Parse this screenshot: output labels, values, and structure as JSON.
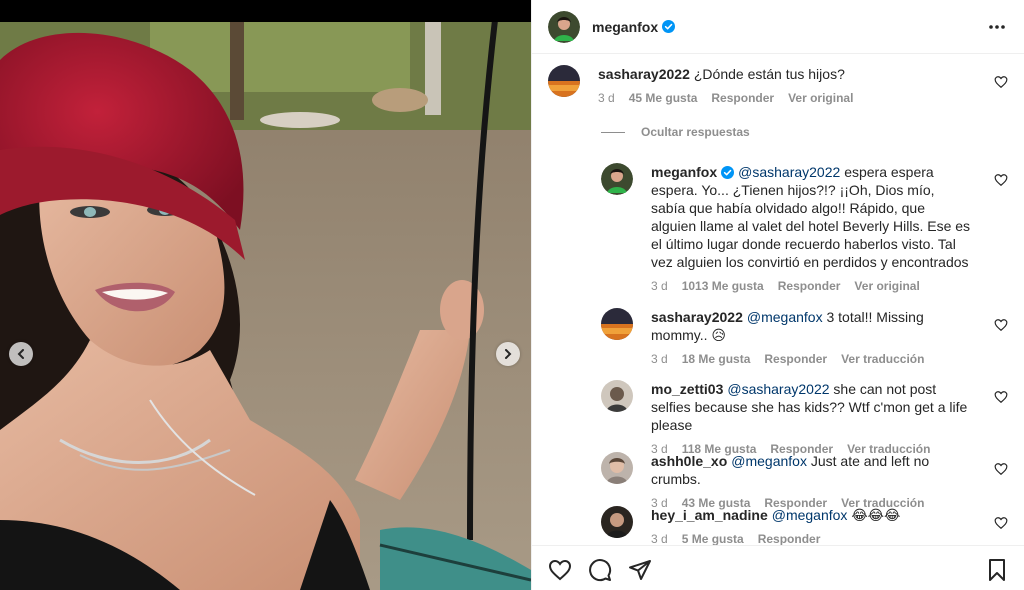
{
  "post": {
    "author": "meganfox",
    "verified": true
  },
  "thread": {
    "hide_replies_label": "Ocultar respuestas",
    "reply_label": "Responder",
    "comments": [
      {
        "user": "sasharay2022",
        "mention": "",
        "text": "¿Dónde están tus hijos?",
        "time": "3 d",
        "likes": "45 Me gusta",
        "translate": "Ver original"
      },
      {
        "user": "meganfox",
        "mention": "@sasharay2022",
        "text": "espera espera espera. Yo... ¿Tienen hijos?!? ¡¡Oh, Dios mío, sabía que había olvidado algo!! Rápido, que alguien llame al valet del hotel Beverly Hills. Ese es el último lugar donde recuerdo haberlos visto. Tal vez alguien los convirtió en perdidos y encontrados",
        "time": "3 d",
        "likes": "1013 Me gusta",
        "translate": "Ver original"
      },
      {
        "user": "sasharay2022",
        "mention": "@meganfox",
        "text": "3 total!! Missing mommy.. 😥",
        "time": "3 d",
        "likes": "18 Me gusta",
        "translate": "Ver traducción"
      },
      {
        "user": "mo_zetti03",
        "mention": "@sasharay2022",
        "text": "she can not post selfies because she has kids?? Wtf c'mon get a life please",
        "time": "3 d",
        "likes": "118 Me gusta",
        "translate": "Ver traducción"
      },
      {
        "user": "ashh0le_xo",
        "mention": "@meganfox",
        "text": "Just ate and left no crumbs.",
        "time": "3 d",
        "likes": "43 Me gusta",
        "translate": "Ver traducción"
      },
      {
        "user": "hey_i_am_nadine",
        "mention": "@meganfox",
        "text": "😂😂😂",
        "time": "3 d",
        "likes": "5 Me gusta",
        "translate": ""
      }
    ]
  },
  "colors": {
    "text": "#262626",
    "secondary": "#8e8e8e",
    "mention": "#00376b",
    "verified": "#0095f6",
    "divider": "#efefef"
  },
  "icons": [
    "more-icon",
    "heart-icon",
    "comment-icon",
    "share-icon",
    "bookmark-icon",
    "chevron-left-icon",
    "chevron-right-icon",
    "verified-badge-icon"
  ]
}
